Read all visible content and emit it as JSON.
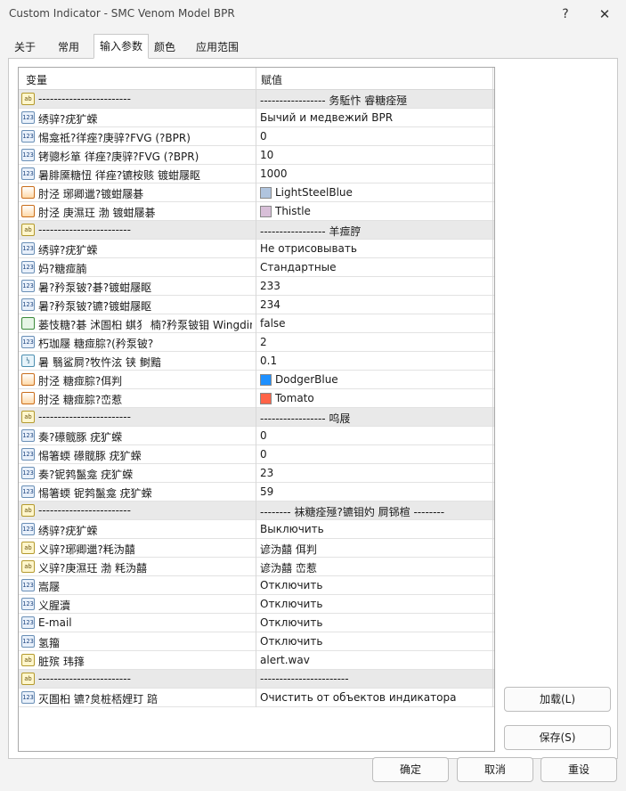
{
  "window": {
    "title": "Custom Indicator - SMC Venom Model BPR",
    "help_label": "?",
    "close_label": "✕"
  },
  "tabs": [
    "关于",
    "常用",
    "输入参数",
    "颜色",
    "应用范围"
  ],
  "grid": {
    "col_name": "变量",
    "col_value": "赋值",
    "rows": [
      {
        "type": "ab",
        "name": "------------------------",
        "value": "-----------------  务駈忭    睿糖痊殛",
        "sep": true
      },
      {
        "type": "123",
        "name": "绣骍?疣犷蝾",
        "value": "Бычий и медвежий BPR"
      },
      {
        "type": "123",
        "name": "惕龛祗?徉痤?庚骍?FVG (?BPR)",
        "value": "0"
      },
      {
        "type": "123",
        "name": "铐骢杉箪 徉痤?庚骍?FVG (?BPR)",
        "value": "10"
      },
      {
        "type": "123",
        "name": "暑腓黡糖忸 徉痤?镳桉赅 镀蚶屦眍",
        "value": "1000"
      },
      {
        "type": "clr",
        "name": "肘泾 琊卿邋?镀蚶屦碁",
        "value": "LightSteelBlue",
        "color": "#b0c4de"
      },
      {
        "type": "clr",
        "name": "肘泾 庚濕玨   渤 镀蚶屦碁",
        "value": "Thistle",
        "color": "#d8bfd8"
      },
      {
        "type": "ab",
        "name": "------------------------",
        "value": "-----------------  羊痖脝",
        "sep": true
      },
      {
        "type": "123",
        "name": "绣骍?疣犷蝾",
        "value": "Не отрисовывать"
      },
      {
        "type": "123",
        "name": "妈?糖痖腩",
        "value": "Стандартные"
      },
      {
        "type": "123",
        "name": "暑?矜泵铍?碁?镀蚶屦眍",
        "value": "233"
      },
      {
        "type": "123",
        "name": "暑?矜泵铍?镳?镀蚶屦眍",
        "value": "234"
      },
      {
        "type": "bool",
        "name": "蒌忮糖?碁 沭圄桕 蜞犭 楠?矜泵铍钼 Wingdings",
        "value": "false"
      },
      {
        "type": "123",
        "name": "朽珈屦 糖痖腙?(矜泵铍?",
        "value": "2"
      },
      {
        "type": "dbl",
        "name": "暑   翳鲨屙?牧忤泫 铗 鲥黯",
        "value": "0.1"
      },
      {
        "type": "clr",
        "name": "肘泾 糖痖腙?佴判",
        "value": "DodgerBlue",
        "color": "#1e90ff"
      },
      {
        "type": "clr",
        "name": "肘泾 糖痖腙?峦惹",
        "value": "Tomato",
        "color": "#ff6347"
      },
      {
        "type": "ab",
        "name": "------------------------",
        "value": "-----------------  呜屐",
        "sep": true
      },
      {
        "type": "123",
        "name": "奏?礤髋豚 疣犷蝾",
        "value": "0"
      },
      {
        "type": "123",
        "name": "惕箸蝡 礤髋豚 疣犷蝾",
        "value": "0"
      },
      {
        "type": "123",
        "name": "奏?铌鹁鬣龛    疣犷蝾",
        "value": "23"
      },
      {
        "type": "123",
        "name": "惕箸蝡 铌鹁鬣龛     疣犷蝾",
        "value": "59"
      },
      {
        "type": "ab",
        "name": "------------------------",
        "value": "--------  袜糖痊殛?镳钼妁 屙铞楦 --------",
        "sep": true
      },
      {
        "type": "123",
        "name": "绣骍?疣犷蝾",
        "value": "Выключить"
      },
      {
        "type": "ab",
        "name": "义骍?琊卿邋?粍沩囍",
        "value": "谚沩囍   佴判"
      },
      {
        "type": "ab",
        "name": "义骍?庚濕玨   渤 粍沩囍",
        "value": "谚沩囍   峦惹"
      },
      {
        "type": "123",
        "name": "嵩屦",
        "value": "Отключить"
      },
      {
        "type": "123",
        "name": "义腥瀆",
        "value": "Отключить"
      },
      {
        "type": "123",
        "name": "E-mail",
        "value": "Отключить"
      },
      {
        "type": "123",
        "name": "氢籀",
        "value": "Отключить"
      },
      {
        "type": "ab",
        "name": "脏殡 玮箨",
        "value": "alert.wav"
      },
      {
        "type": "ab",
        "name": "------------------------",
        "value": "-----------------------",
        "sep": true
      },
      {
        "type": "123",
        "name": "灭圄桕 镳?炱桩桮娌玎 踣",
        "value": "Очистить от объектов индикатора"
      }
    ]
  },
  "buttons": {
    "load": "加载(L)",
    "save": "保存(S)",
    "ok": "确定",
    "cancel": "取消",
    "reset": "重设"
  },
  "type_labels": {
    "123": "123",
    "ab": "ab",
    "clr": "",
    "bool": "",
    "dbl": "½"
  }
}
